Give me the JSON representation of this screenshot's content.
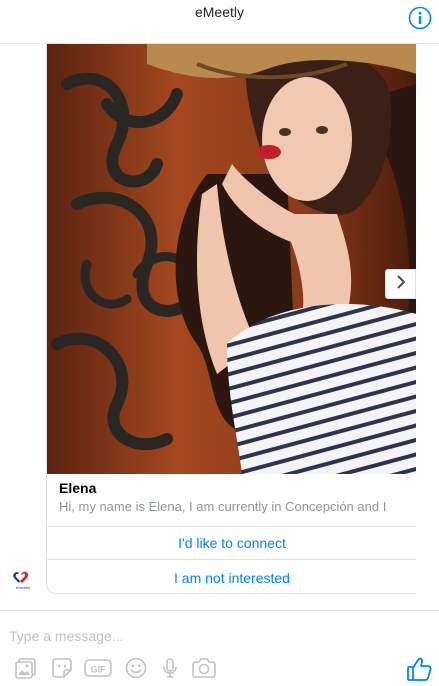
{
  "header": {
    "title": "eMeetly",
    "info_icon": "info-icon"
  },
  "card": {
    "name": "Elena",
    "description": "Hi, my name is Elena, I am currently in Concepción and I",
    "next_icon": "chevron-right-icon",
    "actions": [
      {
        "label": "I'd like to connect"
      },
      {
        "label": "I am not interested"
      }
    ]
  },
  "avatar": {
    "icon": "emeetly-logo-icon",
    "logo_text": "eMeetly"
  },
  "composer": {
    "placeholder": "Type a message...",
    "tools": [
      "image-icon",
      "sticker-icon",
      "gif-icon",
      "emoji-icon",
      "microphone-icon",
      "camera-icon"
    ],
    "gif_text": "GIF",
    "like_icon": "thumbs-up-icon"
  },
  "colors": {
    "accent": "#0084ff",
    "icon_gray": "#bec2c9",
    "border": "#dddfe2",
    "text_secondary": "#90949c"
  }
}
